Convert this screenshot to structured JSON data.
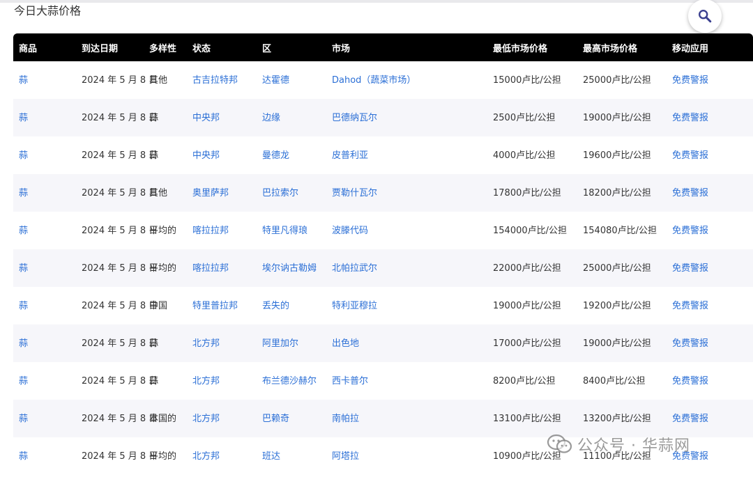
{
  "page": {
    "title": "今日大蒜价格"
  },
  "search": {
    "icon": "search-icon"
  },
  "table": {
    "headers": [
      "商品",
      "到达日期",
      "多样性",
      "状态",
      "区",
      "市场",
      "最低市场价格",
      "最高市场价格",
      "移动应用"
    ],
    "rows": [
      {
        "commodity": "蒜",
        "date": "2024 年 5 月 8 日",
        "variety": "其他",
        "state": "古吉拉特邦",
        "district": "达霍德",
        "market": "Dahod（蔬菜市场）",
        "min": "15000卢比/公担",
        "max": "25000卢比/公担",
        "app": "免费警报"
      },
      {
        "commodity": "蒜",
        "date": "2024 年 5 月 8 日",
        "variety": "蒜",
        "state": "中央邦",
        "district": "边缘",
        "market": "巴德纳瓦尔",
        "min": "2500卢比/公担",
        "max": "19000卢比/公担",
        "app": "免费警报"
      },
      {
        "commodity": "蒜",
        "date": "2024 年 5 月 8 日",
        "variety": "蒜",
        "state": "中央邦",
        "district": "曼德龙",
        "market": "皮普利亚",
        "min": "4000卢比/公担",
        "max": "19600卢比/公担",
        "app": "免费警报"
      },
      {
        "commodity": "蒜",
        "date": "2024 年 5 月 8 日",
        "variety": "其他",
        "state": "奥里萨邦",
        "district": "巴拉索尔",
        "market": "贾勒什瓦尔",
        "min": "17800卢比/公担",
        "max": "18200卢比/公担",
        "app": "免费警报"
      },
      {
        "commodity": "蒜",
        "date": "2024 年 5 月 8 日",
        "variety": "平均的",
        "state": "喀拉拉邦",
        "district": "特里凡得琅",
        "market": "波滕代码",
        "min": "154000卢比/公担",
        "max": "154080卢比/公担",
        "app": "免费警报"
      },
      {
        "commodity": "蒜",
        "date": "2024 年 5 月 8 日",
        "variety": "平均的",
        "state": "喀拉拉邦",
        "district": "埃尔讷古勒姆",
        "market": "北帕拉武尔",
        "min": "22000卢比/公担",
        "max": "25000卢比/公担",
        "app": "免费警报"
      },
      {
        "commodity": "蒜",
        "date": "2024 年 5 月 8 日",
        "variety": "中国",
        "state": "特里普拉邦",
        "district": "丢失的",
        "market": "特利亚穆拉",
        "min": "19000卢比/公担",
        "max": "19200卢比/公担",
        "app": "免费警报"
      },
      {
        "commodity": "蒜",
        "date": "2024 年 5 月 8 日",
        "variety": "蒜",
        "state": "北方邦",
        "district": "阿里加尔",
        "market": "出色地",
        "min": "17000卢比/公担",
        "max": "19000卢比/公担",
        "app": "免费警报"
      },
      {
        "commodity": "蒜",
        "date": "2024 年 5 月 8 日",
        "variety": "蒜",
        "state": "北方邦",
        "district": "布兰德沙赫尔",
        "market": "西卡普尔",
        "min": "8200卢比/公担",
        "max": "8400卢比/公担",
        "app": "免费警报"
      },
      {
        "commodity": "蒜",
        "date": "2024 年 5 月 8 日",
        "variety": "本国的",
        "state": "北方邦",
        "district": "巴赖奇",
        "market": "南帕拉",
        "min": "13100卢比/公担",
        "max": "13200卢比/公担",
        "app": "免费警报"
      },
      {
        "commodity": "蒜",
        "date": "2024 年 5 月 8 日",
        "variety": "平均的",
        "state": "北方邦",
        "district": "班达",
        "market": "阿塔拉",
        "min": "10900卢比/公担",
        "max": "11100卢比/公担",
        "app": "免费警报"
      }
    ]
  },
  "watermark": {
    "text": "公众号 · 华蒜网",
    "icon": "wechat-icon"
  },
  "colors": {
    "link": "#2b6fd6",
    "header_bg": "#000000",
    "row_alt": "#f6f6fa"
  }
}
